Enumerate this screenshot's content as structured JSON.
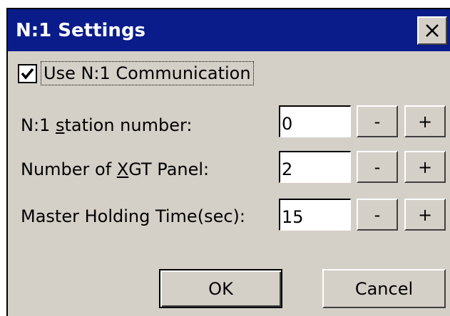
{
  "dialog": {
    "title": "N:1 Settings",
    "close_icon": "close-icon"
  },
  "use_n1": {
    "label": "Use N:1 Communication",
    "checked": true,
    "check_icon": "checkmark-icon"
  },
  "fields": [
    {
      "label_before": "N:1 ",
      "label_mnemonic": "s",
      "label_after": "tation number:",
      "value": "0",
      "minus": "-",
      "plus": "+"
    },
    {
      "label_before": "Number of ",
      "label_mnemonic": "X",
      "label_after": "GT Panel:",
      "value": "2",
      "minus": "-",
      "plus": "+"
    },
    {
      "label_before": "Master Holding Time(sec):",
      "label_mnemonic": "",
      "label_after": "",
      "value": "15",
      "minus": "-",
      "plus": "+"
    }
  ],
  "buttons": {
    "ok": "OK",
    "cancel": "Cancel"
  },
  "colors": {
    "titlebar": "#0a1c8a",
    "face": "#d4d0c8"
  }
}
